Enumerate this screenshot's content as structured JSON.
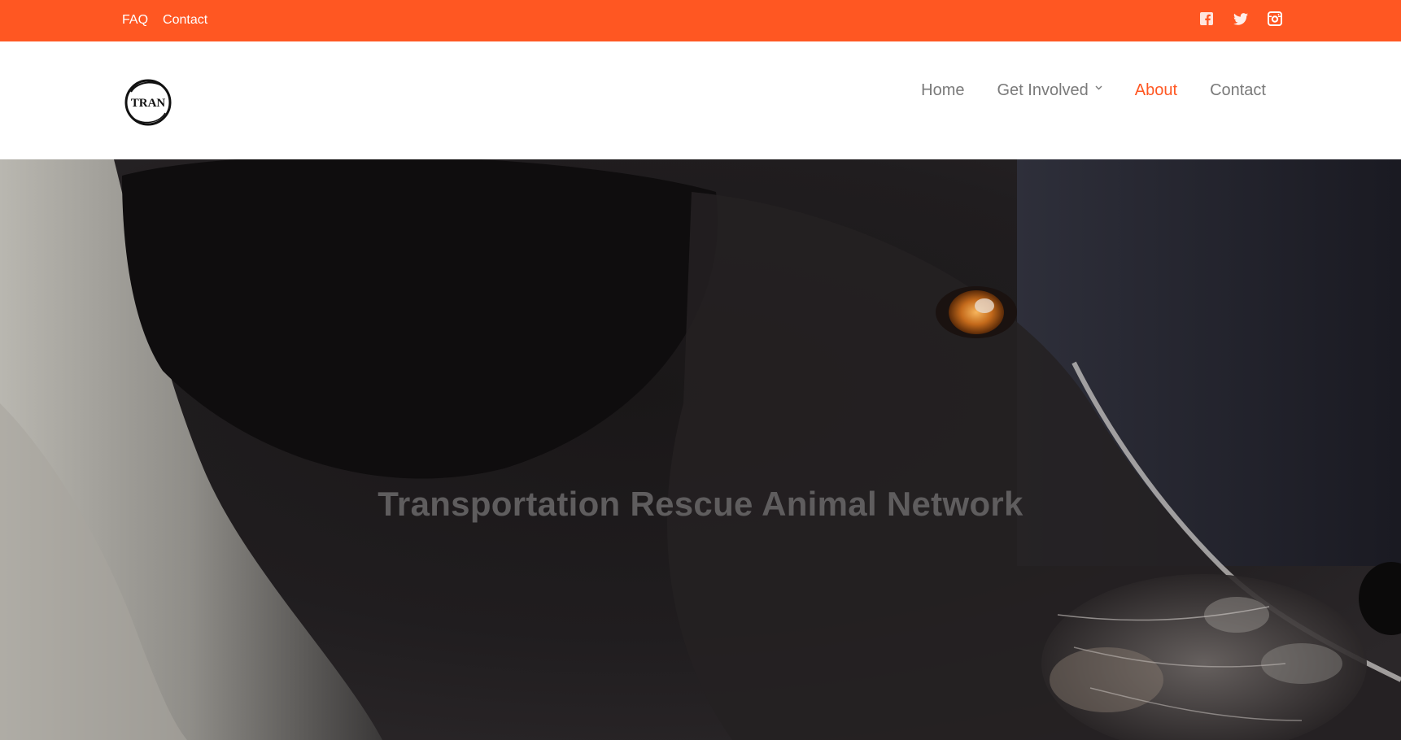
{
  "topbar": {
    "background": "#ff5722",
    "links": [
      {
        "label": "FAQ"
      },
      {
        "label": "Contact"
      }
    ],
    "social": [
      {
        "icon": "facebook-icon"
      },
      {
        "icon": "twitter-icon"
      },
      {
        "icon": "instagram-icon"
      }
    ]
  },
  "header": {
    "logo_text": "TRAN",
    "nav": [
      {
        "label": "Home",
        "active": false
      },
      {
        "label": "Get Involved",
        "active": false,
        "has_dropdown": true
      },
      {
        "label": "About",
        "active": true
      },
      {
        "label": "Contact",
        "active": false
      }
    ],
    "accent_color": "#ff5722"
  },
  "hero": {
    "title": "Transportation Rescue Animal Network",
    "image_subject": "close-up of black and white dog with amber eye"
  }
}
